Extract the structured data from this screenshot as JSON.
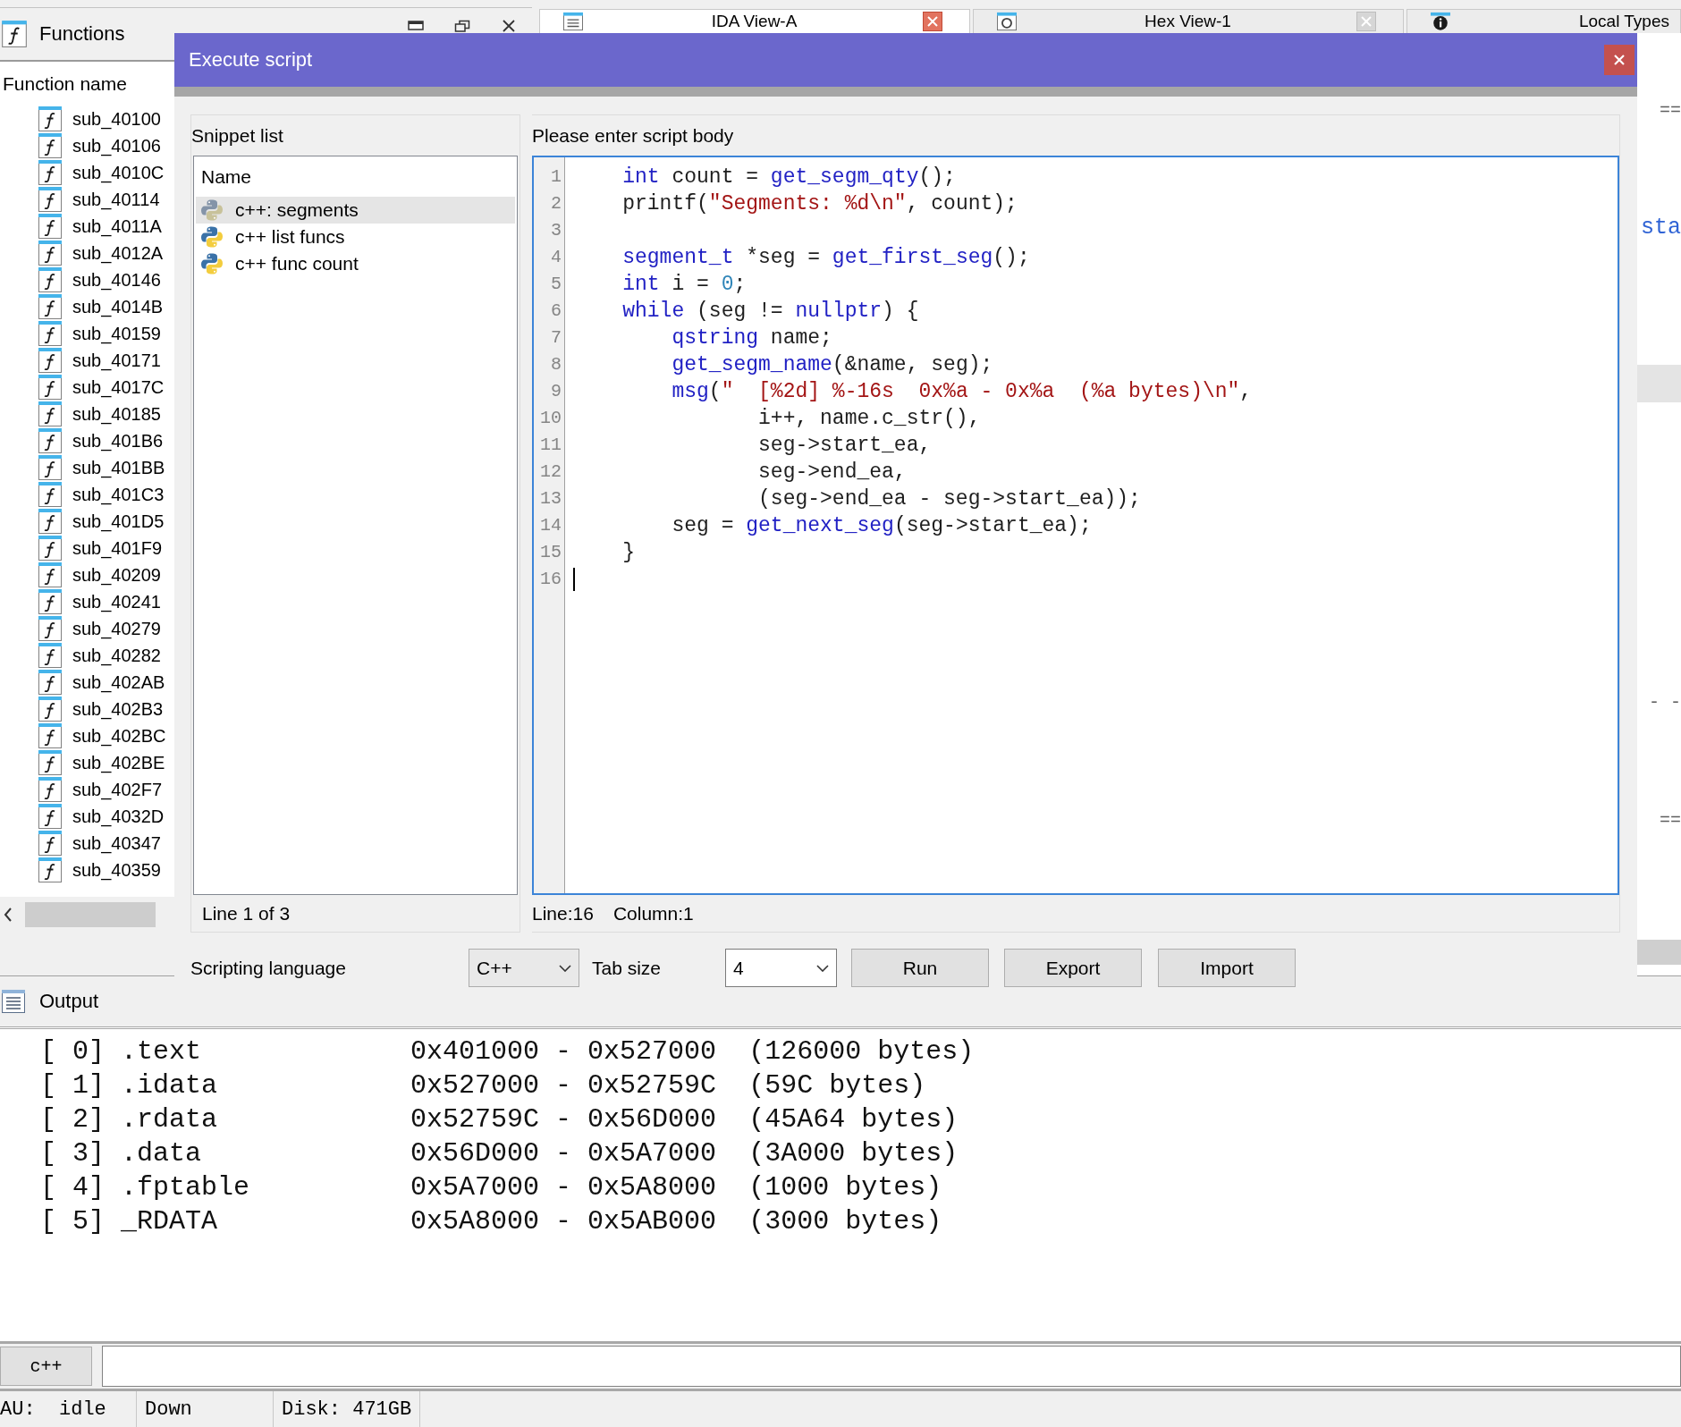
{
  "functions_panel": {
    "title": "Functions",
    "column": "Function name",
    "items": [
      "sub_40100",
      "sub_40106",
      "sub_4010C",
      "sub_40114",
      "sub_4011A",
      "sub_4012A",
      "sub_40146",
      "sub_4014B",
      "sub_40159",
      "sub_40171",
      "sub_4017C",
      "sub_40185",
      "sub_401B6",
      "sub_401BB",
      "sub_401C3",
      "sub_401D5",
      "sub_401F9",
      "sub_40209",
      "sub_40241",
      "sub_40279",
      "sub_40282",
      "sub_402AB",
      "sub_402B3",
      "sub_402BC",
      "sub_402BE",
      "sub_402F7",
      "sub_4032D",
      "sub_40347",
      "sub_40359"
    ]
  },
  "tabs": [
    {
      "label": "IDA View-A",
      "kind": "disassembly",
      "selected": true,
      "close_button": true
    },
    {
      "label": "Hex View-1",
      "kind": "hex",
      "selected": false,
      "close_button": true
    },
    {
      "label": "Local Types",
      "kind": "types",
      "selected": false,
      "close_button": false
    }
  ],
  "ida_view": {
    "fragments": [
      {
        "text": "==",
        "kind": "plain"
      },
      {
        "text": "sta",
        "kind": "name"
      },
      {
        "text": "- -",
        "kind": "plain"
      },
      {
        "text": "==",
        "kind": "plain"
      }
    ]
  },
  "dialog": {
    "title": "Execute script",
    "snippets": {
      "label": "Snippet list",
      "column": "Name",
      "items": [
        {
          "name": "c++: segments",
          "selected": true
        },
        {
          "name": "c++ list funcs",
          "selected": false
        },
        {
          "name": "c++ func count",
          "selected": false
        }
      ],
      "status": "Line 1 of 3"
    },
    "editor": {
      "label": "Please enter script body",
      "status": [
        "Line:16",
        "Column:1"
      ],
      "lines": [
        {
          "number": "1",
          "cursor": false,
          "tokens": [
            {
              "text": "    int",
              "kind": "keyword"
            },
            {
              "text": " count = ",
              "kind": "plain"
            },
            {
              "text": "get_segm_qty",
              "kind": "keyword"
            },
            {
              "text": "();",
              "kind": "plain"
            }
          ]
        },
        {
          "number": "2",
          "cursor": false,
          "tokens": [
            {
              "text": "    printf(",
              "kind": "plain"
            },
            {
              "text": "\"Segments: %d\\n\"",
              "kind": "string"
            },
            {
              "text": ", count);",
              "kind": "plain"
            }
          ]
        },
        {
          "number": "3",
          "cursor": false
        },
        {
          "number": "4",
          "cursor": false,
          "tokens": [
            {
              "text": "    segment_t",
              "kind": "keyword"
            },
            {
              "text": " *seg = ",
              "kind": "plain"
            },
            {
              "text": "get_first_seg",
              "kind": "keyword"
            },
            {
              "text": "();",
              "kind": "plain"
            }
          ]
        },
        {
          "number": "5",
          "cursor": false,
          "tokens": [
            {
              "text": "    int",
              "kind": "keyword"
            },
            {
              "text": " i = ",
              "kind": "plain"
            },
            {
              "text": "0",
              "kind": "number"
            },
            {
              "text": ";",
              "kind": "plain"
            }
          ]
        },
        {
          "number": "6",
          "cursor": false,
          "tokens": [
            {
              "text": "    while",
              "kind": "keyword"
            },
            {
              "text": " (seg != ",
              "kind": "plain"
            },
            {
              "text": "nullptr",
              "kind": "keyword"
            },
            {
              "text": ") {",
              "kind": "plain"
            }
          ]
        },
        {
          "number": "7",
          "cursor": false,
          "tokens": [
            {
              "text": "        qstring",
              "kind": "keyword"
            },
            {
              "text": " name;",
              "kind": "plain"
            }
          ]
        },
        {
          "number": "8",
          "cursor": false,
          "tokens": [
            {
              "text": "        get_segm_name",
              "kind": "keyword"
            },
            {
              "text": "(&name, seg);",
              "kind": "plain"
            }
          ]
        },
        {
          "number": "9",
          "cursor": false,
          "tokens": [
            {
              "text": "        msg",
              "kind": "keyword"
            },
            {
              "text": "(",
              "kind": "plain"
            },
            {
              "text": "\"  [%2d] %-16s  0x%a - 0x%a  (%a bytes)\\n\"",
              "kind": "string"
            },
            {
              "text": ",",
              "kind": "plain"
            }
          ]
        },
        {
          "number": "10",
          "cursor": false,
          "tokens": [
            {
              "text": "               i++, name.c_str(),",
              "kind": "plain"
            }
          ]
        },
        {
          "number": "11",
          "cursor": false,
          "tokens": [
            {
              "text": "               seg->start_ea,",
              "kind": "plain"
            }
          ]
        },
        {
          "number": "12",
          "cursor": false,
          "tokens": [
            {
              "text": "               seg->end_ea,",
              "kind": "plain"
            }
          ]
        },
        {
          "number": "13",
          "cursor": false,
          "tokens": [
            {
              "text": "               (seg->end_ea - seg->start_ea));",
              "kind": "plain"
            }
          ]
        },
        {
          "number": "14",
          "cursor": false,
          "tokens": [
            {
              "text": "        seg = ",
              "kind": "plain"
            },
            {
              "text": "get_next_seg",
              "kind": "keyword"
            },
            {
              "text": "(seg->start_ea);",
              "kind": "plain"
            }
          ]
        },
        {
          "number": "15",
          "cursor": false,
          "tokens": [
            {
              "text": "    }",
              "kind": "plain"
            }
          ]
        },
        {
          "number": "16",
          "cursor": true
        }
      ]
    },
    "language": {
      "label": "Scripting language",
      "value": "C++"
    },
    "tab_size": {
      "label": "Tab size",
      "value": "4"
    },
    "buttons": [
      {
        "label": "Run"
      },
      {
        "label": "Export"
      },
      {
        "label": "Import"
      }
    ]
  },
  "output": {
    "title": "Output",
    "lines": [
      "[ 0] .text             0x401000 - 0x527000  (126000 bytes)",
      "[ 1] .idata            0x527000 - 0x52759C  (59C bytes)",
      "[ 2] .rdata            0x52759C - 0x56D000  (45A64 bytes)",
      "[ 3] .data             0x56D000 - 0x5A7000  (3A000 bytes)",
      "[ 4] .fptable          0x5A7000 - 0x5A8000  (1000 bytes)",
      "[ 5] _RDATA            0x5A8000 - 0x5AB000  (3000 bytes)"
    ]
  },
  "command": {
    "language": "c++"
  },
  "status_bar": [
    "AU:  idle",
    "Down",
    "Disk: 471GB"
  ]
}
